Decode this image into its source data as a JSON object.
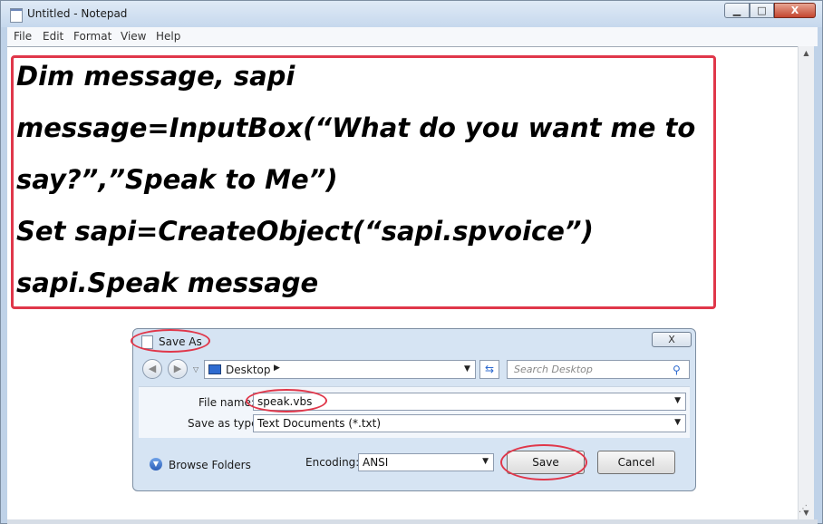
{
  "window": {
    "title": "Untitled - Notepad",
    "min_glyph": "▁",
    "max_glyph": "□",
    "close_glyph": "X"
  },
  "menu": [
    "File",
    "Edit",
    "Format",
    "View",
    "Help"
  ],
  "editor": {
    "lines": [
      "Dim message, sapi",
      "message=InputBox(“What do you want me to",
      "say?”,”Speak to Me”)",
      "Set sapi=CreateObject(“sapi.spvoice”)",
      "sapi.Speak message"
    ]
  },
  "save_dialog": {
    "title": "Save As",
    "address": "Desktop",
    "search_placeholder": "Search Desktop",
    "file_name_label": "File name:",
    "file_name_value": "speak.vbs",
    "save_as_type_label": "Save as type:",
    "save_as_type_value": "Text Documents (*.txt)",
    "browse_folders": "Browse Folders",
    "encoding_label": "Encoding:",
    "encoding_value": "ANSI",
    "save_label": "Save",
    "cancel_label": "Cancel"
  },
  "colors": {
    "annotation": "#e0374a",
    "titlebar": "#c6d8ed",
    "dialog_bg": "#d6e4f3"
  },
  "icons": [
    "notepad-icon",
    "back-icon",
    "forward-icon",
    "folder-icon",
    "refresh-icon",
    "search-icon",
    "browse-folders-icon"
  ]
}
